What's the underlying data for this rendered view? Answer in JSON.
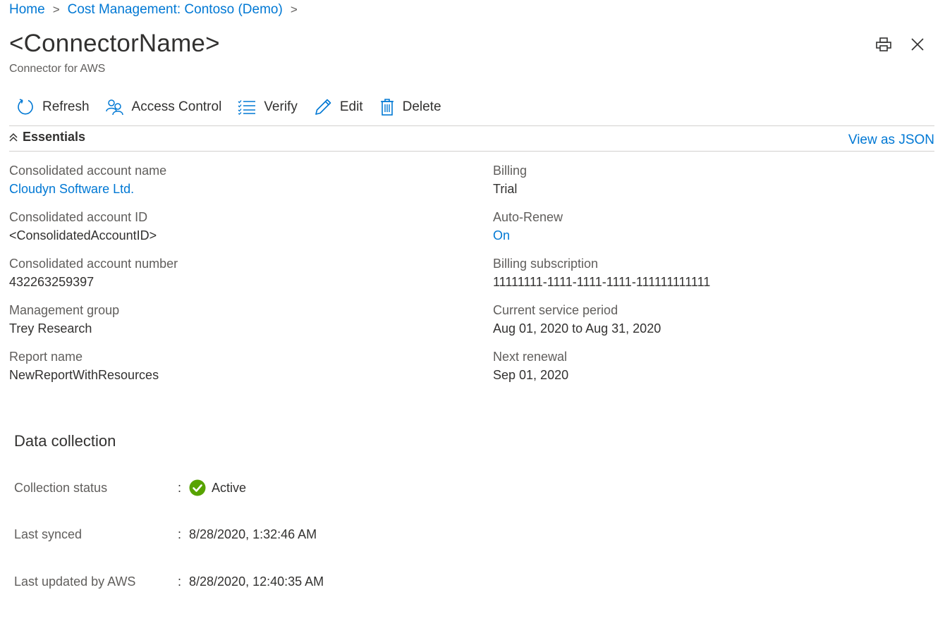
{
  "breadcrumb": {
    "items": [
      "Home",
      "Cost Management: Contoso (Demo)"
    ],
    "separator": ">"
  },
  "header": {
    "title": "<ConnectorName>",
    "subtitle": "Connector for AWS",
    "icons": [
      "print-icon",
      "close-icon"
    ]
  },
  "toolbar": {
    "refresh": "Refresh",
    "access_control": "Access Control",
    "verify": "Verify",
    "edit": "Edit",
    "delete": "Delete"
  },
  "essentials": {
    "header": "Essentials",
    "view_json": "View as JSON",
    "left": [
      {
        "label": "Consolidated account name",
        "value": "Cloudyn Software Ltd.",
        "link": true
      },
      {
        "label": "Consolidated account ID",
        "value": "<ConsolidatedAccountID>",
        "link": false
      },
      {
        "label": "Consolidated account number",
        "value": "432263259397",
        "link": false
      },
      {
        "label": "Management group",
        "value": "Trey Research",
        "link": false
      },
      {
        "label": "Report name",
        "value": "NewReportWithResources",
        "link": false
      }
    ],
    "right": [
      {
        "label": "Billing",
        "value": "Trial",
        "link": false
      },
      {
        "label": "Auto-Renew",
        "value": "On",
        "link": true
      },
      {
        "label": "Billing subscription",
        "value": "11111111-1111-1111-1111-111111111111",
        "link": false
      },
      {
        "label": "Current service period",
        "value": "Aug 01, 2020 to Aug 31, 2020",
        "link": false
      },
      {
        "label": "Next renewal",
        "value": "Sep 01, 2020",
        "link": false
      }
    ]
  },
  "data_collection": {
    "title": "Data collection",
    "rows": [
      {
        "label": "Collection status",
        "value": "Active",
        "status_icon": "check-circle-icon"
      },
      {
        "label": "Last synced",
        "value": "8/28/2020, 1:32:46 AM"
      },
      {
        "label": "Last updated by AWS",
        "value": "8/28/2020, 12:40:35 AM"
      }
    ],
    "separator": ":"
  },
  "colors": {
    "accent": "#0078d4",
    "status_active": "#57a300",
    "text_primary": "#323130",
    "text_secondary": "#605e5c"
  }
}
